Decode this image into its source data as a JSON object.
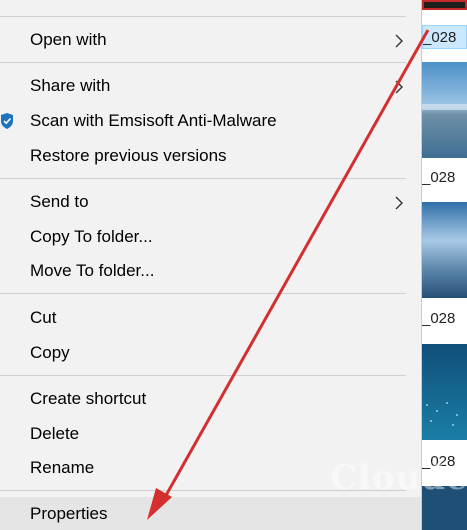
{
  "menu": {
    "top_partial_label": "",
    "items": [
      {
        "label": "Open with",
        "has_submenu": true
      },
      {
        "label": "Share with",
        "has_submenu": true
      },
      {
        "label": "Scan with Emsisoft Anti-Malware",
        "has_submenu": false,
        "icon": "shield-icon"
      },
      {
        "label": "Restore previous versions",
        "has_submenu": false
      },
      {
        "label": "Send to",
        "has_submenu": true
      },
      {
        "label": "Copy To folder...",
        "has_submenu": false
      },
      {
        "label": "Move To folder...",
        "has_submenu": false
      },
      {
        "label": "Cut",
        "has_submenu": false
      },
      {
        "label": "Copy",
        "has_submenu": false
      },
      {
        "label": "Create shortcut",
        "has_submenu": false
      },
      {
        "label": "Delete",
        "has_submenu": false
      },
      {
        "label": "Rename",
        "has_submenu": false
      },
      {
        "label": "Properties",
        "has_submenu": false,
        "highlighted": true
      }
    ]
  },
  "files": [
    {
      "name": "_028"
    },
    {
      "name": "_028"
    },
    {
      "name": "_028"
    },
    {
      "name": "_028"
    }
  ],
  "annotation": {
    "arrow_color": "#d32f2f",
    "watermark": "Cloude"
  },
  "colors": {
    "menu_bg": "#f2f2f2",
    "highlight": "#e5e5e5",
    "selection": "#cce8ff",
    "shield_blue": "#1e73be"
  }
}
